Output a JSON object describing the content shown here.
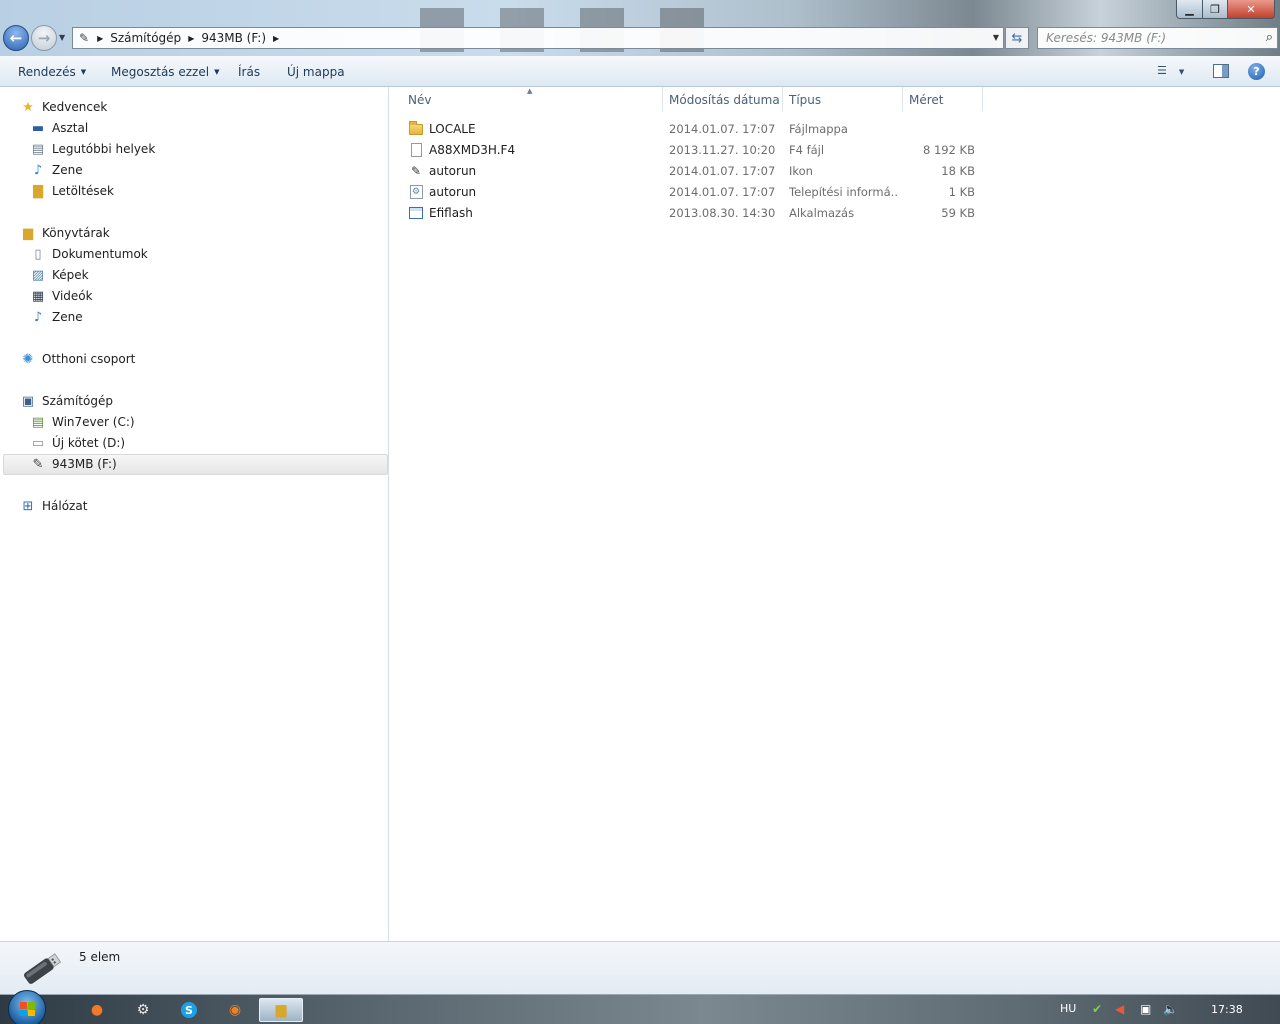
{
  "window": {
    "minimize_icon": "minimize-icon",
    "maximize_icon": "restore-icon",
    "close_icon": "close-icon"
  },
  "address": {
    "drive_icon": "usb-drive-icon",
    "segments": [
      "Számítógép",
      "943MB (F:)"
    ]
  },
  "search": {
    "placeholder": "Keresés: 943MB (F:)"
  },
  "commands": {
    "organize": "Rendezés",
    "share": "Megosztás ezzel",
    "burn": "Írás",
    "new_folder": "Új mappa"
  },
  "nav": {
    "favorites": {
      "label": "Kedvencek",
      "items": [
        "Asztal",
        "Legutóbbi helyek",
        "Zene",
        "Letöltések"
      ]
    },
    "libraries": {
      "label": "Könyvtárak",
      "items": [
        "Dokumentumok",
        "Képek",
        "Videók",
        "Zene"
      ]
    },
    "homegroup": {
      "label": "Otthoni csoport"
    },
    "computer": {
      "label": "Számítógép",
      "items": [
        "Win7ever (C:)",
        "Új kötet (D:)",
        "943MB (F:)"
      ]
    },
    "network": {
      "label": "Hálózat"
    },
    "selected": "943MB (F:)"
  },
  "columns": {
    "name": "Név",
    "date": "Módosítás dátuma",
    "type": "Típus",
    "size": "Méret"
  },
  "files": [
    {
      "name": "LOCALE",
      "date": "2014.01.07. 17:07",
      "type": "Fájlmappa",
      "size": "",
      "icon": "folder-icon"
    },
    {
      "name": "A88XMD3H.F4",
      "date": "2013.11.27. 10:20",
      "type": "F4 fájl",
      "size": "8 192 KB",
      "icon": "file-icon"
    },
    {
      "name": "autorun",
      "date": "2014.01.07. 17:07",
      "type": "Ikon",
      "size": "18 KB",
      "icon": "usb-drive-icon"
    },
    {
      "name": "autorun",
      "date": "2014.01.07. 17:07",
      "type": "Telepítési informá...",
      "size": "1 KB",
      "icon": "settings-file-icon"
    },
    {
      "name": "Efiflash",
      "date": "2013.08.30. 14:30",
      "type": "Alkalmazás",
      "size": "59 KB",
      "icon": "application-icon"
    }
  ],
  "status": {
    "item_count": "5 elem"
  },
  "taskbar": {
    "language": "HU",
    "clock": "17:38",
    "apps": [
      "media-player-icon",
      "steam-icon",
      "skype-icon",
      "firefox-icon",
      "explorer-icon"
    ]
  }
}
